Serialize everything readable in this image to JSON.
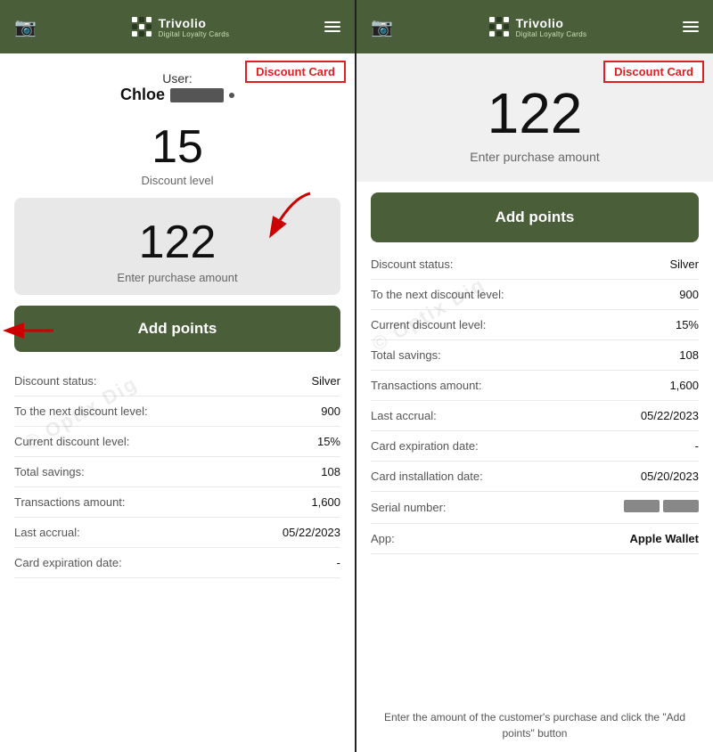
{
  "app": {
    "name": "Trivolio",
    "subtitle": "Digital Loyalty Cards"
  },
  "discount_badge": "Discount Card",
  "left_panel": {
    "user_label": "User:",
    "user_name": "Chloe",
    "discount_level_value": "15",
    "discount_level_label": "Discount level",
    "amount_value": "122",
    "amount_placeholder": "Enter purchase amount",
    "add_points_label": "Add points",
    "info_rows": [
      {
        "label": "Discount status:",
        "value": "Silver"
      },
      {
        "label": "To the next discount level:",
        "value": "900"
      },
      {
        "label": "Current discount level:",
        "value": "15%"
      },
      {
        "label": "Total savings:",
        "value": "108"
      },
      {
        "label": "Transactions amount:",
        "value": "1,600"
      },
      {
        "label": "Last accrual:",
        "value": "05/22/2023"
      },
      {
        "label": "Card expiration date:",
        "value": "-"
      }
    ]
  },
  "right_panel": {
    "discount_badge": "Discount Card",
    "amount_value": "122",
    "amount_placeholder": "Enter purchase amount",
    "add_points_label": "Add points",
    "info_rows": [
      {
        "label": "Discount status:",
        "value": "Silver"
      },
      {
        "label": "To the next discount level:",
        "value": "900"
      },
      {
        "label": "Current discount level:",
        "value": "15%"
      },
      {
        "label": "Total savings:",
        "value": "108"
      },
      {
        "label": "Transactions amount:",
        "value": "1,600"
      },
      {
        "label": "Last accrual:",
        "value": "05/22/2023"
      },
      {
        "label": "Card expiration date:",
        "value": "-"
      },
      {
        "label": "Card installation date:",
        "value": "05/20/2023"
      },
      {
        "label": "Serial number:",
        "value": ""
      },
      {
        "label": "App:",
        "value": "Apple Wallet"
      }
    ],
    "footer_note": "Enter the amount of the customer's purchase and click the \"Add points\" button"
  },
  "watermark_text": "© Optix Dig"
}
